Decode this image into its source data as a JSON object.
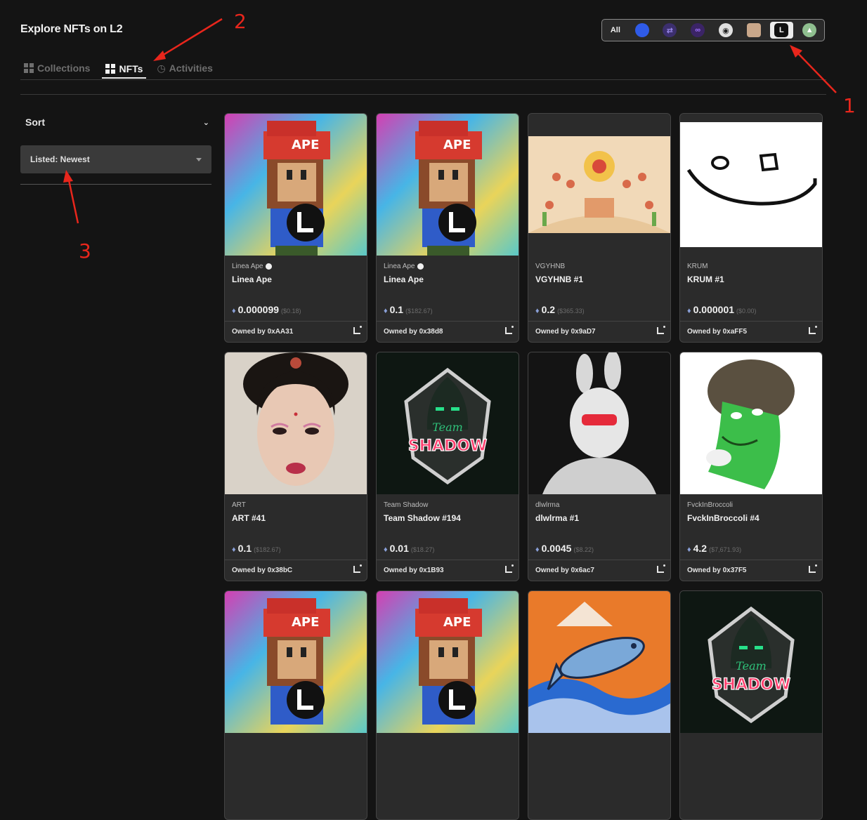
{
  "page": {
    "title": "Explore NFTs on L2"
  },
  "chain_filter": {
    "all_label": "All",
    "chains": [
      {
        "icon": "ethereum-blue-icon",
        "color": "#2f5be8"
      },
      {
        "icon": "arbitrum-icon",
        "color": "#3c2f6e"
      },
      {
        "icon": "polygon-icon",
        "color": "#7b3fe4"
      },
      {
        "icon": "zksync-icon",
        "color": "#e0e0e0"
      },
      {
        "icon": "avatar-chain-icon",
        "color": "#c9a78a"
      },
      {
        "icon": "linea-icon",
        "color": "#111111",
        "active": true
      },
      {
        "icon": "mountain-chain-icon",
        "color": "#8fbf8f"
      }
    ]
  },
  "tabs": [
    {
      "label": "Collections",
      "icon": "grid-icon"
    },
    {
      "label": "NFTs",
      "icon": "grid-icon",
      "active": true
    },
    {
      "label": "Activities",
      "icon": "history-icon"
    }
  ],
  "sidebar": {
    "sort_label": "Sort",
    "sort_value": "Listed: Newest"
  },
  "annotations": [
    "1",
    "2",
    "3"
  ],
  "cards": [
    {
      "collection": "Linea Ape",
      "verified": true,
      "name": "Linea Ape",
      "price": "0.000099",
      "usd": "($0.18)",
      "owner_prefix": "Owned by",
      "owner": "0xAA31",
      "art": "ape"
    },
    {
      "collection": "Linea Ape",
      "verified": true,
      "name": "Linea Ape",
      "price": "0.1",
      "usd": "($182.67)",
      "owner_prefix": "Owned by",
      "owner": "0x38d8",
      "art": "ape"
    },
    {
      "collection": "VGYHNB",
      "verified": false,
      "name": "VGYHNB #1",
      "price": "0.2",
      "usd": "($365.33)",
      "owner_prefix": "Owned by",
      "owner": "0x9aD7",
      "art": "painting"
    },
    {
      "collection": "KRUM",
      "verified": false,
      "name": "KRUM #1",
      "price": "0.000001",
      "usd": "($0.00)",
      "owner_prefix": "Owned by",
      "owner": "0xaFF5",
      "art": "smile"
    },
    {
      "collection": "ART",
      "verified": false,
      "name": "ART #41",
      "price": "0.1",
      "usd": "($182.67)",
      "owner_prefix": "Owned by",
      "owner": "0x38bC",
      "art": "portrait"
    },
    {
      "collection": "Team Shadow",
      "verified": false,
      "name": "Team Shadow #194",
      "price": "0.01",
      "usd": "($18.27)",
      "owner_prefix": "Owned by",
      "owner": "0x1B93",
      "art": "shadow"
    },
    {
      "collection": "dlwlrma",
      "verified": false,
      "name": "dlwlrma #1",
      "price": "0.0045",
      "usd": "($8.22)",
      "owner_prefix": "Owned by",
      "owner": "0x6ac7",
      "art": "rabbit"
    },
    {
      "collection": "FvckInBroccoli",
      "verified": false,
      "name": "FvckInBroccoli #4",
      "price": "4.2",
      "usd": "($7,671.93)",
      "owner_prefix": "Owned by",
      "owner": "0x37F5",
      "art": "broccoli"
    },
    {
      "art": "ape"
    },
    {
      "art": "ape"
    },
    {
      "art": "fish"
    },
    {
      "art": "shadow"
    }
  ]
}
